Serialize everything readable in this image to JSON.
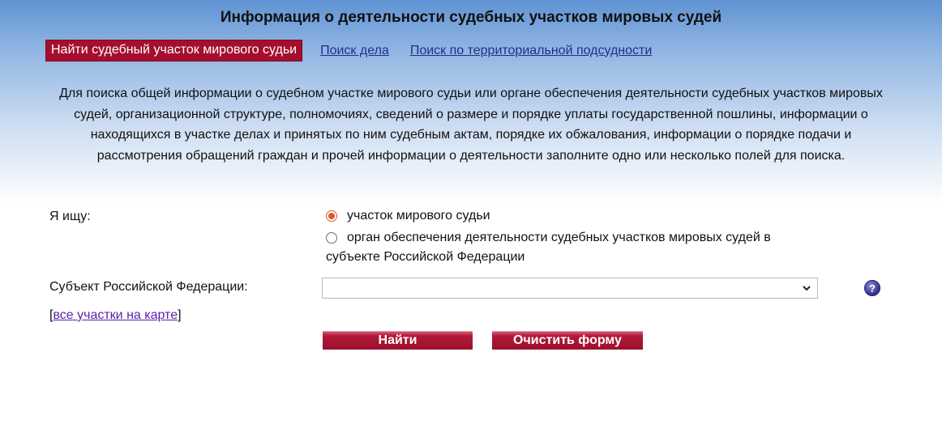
{
  "page_title": "Информация о деятельности судебных участков мировых судей",
  "tabs": {
    "active": "Найти судебный участок мирового судьи",
    "case_search": "Поиск дела",
    "territorial_search": "Поиск по территориальной подсудности"
  },
  "intro_text": "Для поиска общей информации о судебном участке мирового судьи или органе обеспечения деятельности судебных участков мировых судей, организационной структуре, полномочиях, сведений о размере и порядке уплаты государственной пошлины, информации о находящихся в участке делах и принятых по ним судебным актам, порядке их обжалования, информации о порядке подачи и рассмотрения обращений граждан и прочей информации о деятельности заполните одно или несколько полей для поиска.",
  "form": {
    "seek_label": "Я ищу:",
    "options": [
      {
        "label": "участок мирового судьи",
        "checked": true
      },
      {
        "label_line1": "орган обеспечения деятельности судебных участков мировых судей в",
        "label_line2": "субъекте Российской Федерации",
        "checked": false
      }
    ],
    "subject_label": "Субъект Российской Федерации:",
    "subject_value": "",
    "help_symbol": "?",
    "map_link_open": "[",
    "map_link": "все участки на карте",
    "map_link_close": "]"
  },
  "buttons": {
    "find": "Найти",
    "clear": "Очистить форму"
  },
  "colors": {
    "accent": "#a50f2d",
    "link": "#1f2f8a",
    "radio_checked": "#e0572a"
  }
}
